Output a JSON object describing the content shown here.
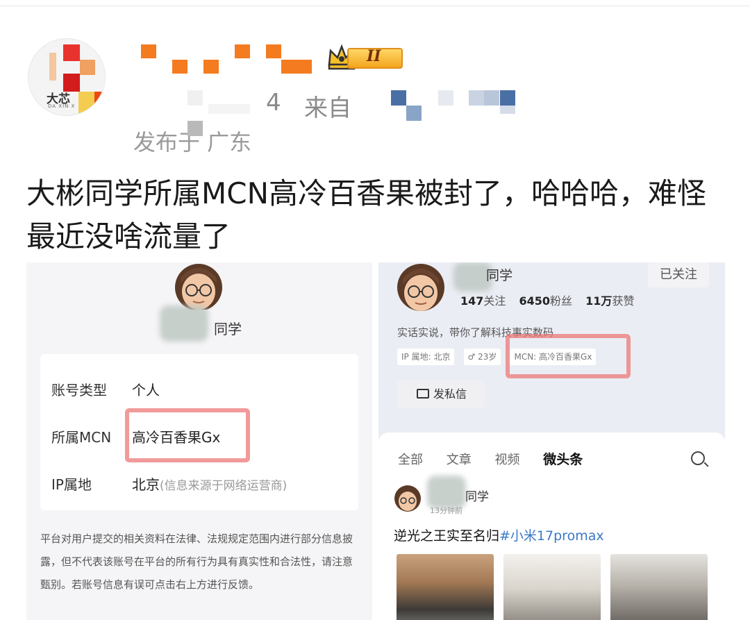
{
  "header": {
    "avatar_logo_text": "大芯",
    "avatar_logo_sub": "DA XIN X",
    "rank_badge": "II",
    "meta_time_fragment": "4",
    "meta_source_label": "来自",
    "location": "发布于 广东"
  },
  "post": {
    "text": "大彬同学所属MCN高冷百香果被封了，哈哈哈，难怪最近没啥流量了"
  },
  "left_screenshot": {
    "username_fragment": "同学",
    "rows": [
      {
        "label": "账号类型",
        "value": "个人",
        "note": ""
      },
      {
        "label": "所属MCN",
        "value": "高冷百香果Gx",
        "note": ""
      },
      {
        "label": "IP属地",
        "value": "北京",
        "note": "(信息来源于网络运营商)"
      }
    ],
    "disclaimer": "平台对用户提交的相关资料在法律、法规规定范围内进行部分信息披露，但不代表该账号在平台的所有行为具有真实性和合法性，请注意甄别。若账号信息有误可点击右上方进行反馈。"
  },
  "right_screenshot": {
    "username_fragment": "同学",
    "follow_button": "已关注",
    "stats": {
      "following": "147",
      "following_label": "关注",
      "fans": "6450",
      "fans_label": "粉丝",
      "likes": "11万",
      "likes_label": "获赞"
    },
    "bio": "实话实说，带你了解科技事实数码",
    "tags": [
      "IP 属地: 北京",
      "♂ 23岁",
      "MCN: 高冷百香果Gx"
    ],
    "dm_button": "发私信",
    "tabs": [
      "全部",
      "文章",
      "视频",
      "微头条"
    ],
    "active_tab": "微头条",
    "post_author_fragment": "同学",
    "post_time": "13分钟前",
    "post_title": "逆光之王实至名归",
    "post_topic": "#小米17promax"
  },
  "colors": {
    "highlight_box": "#ec7878",
    "topic_link": "#3a77c9",
    "badge_gold": "#f3a51f"
  }
}
